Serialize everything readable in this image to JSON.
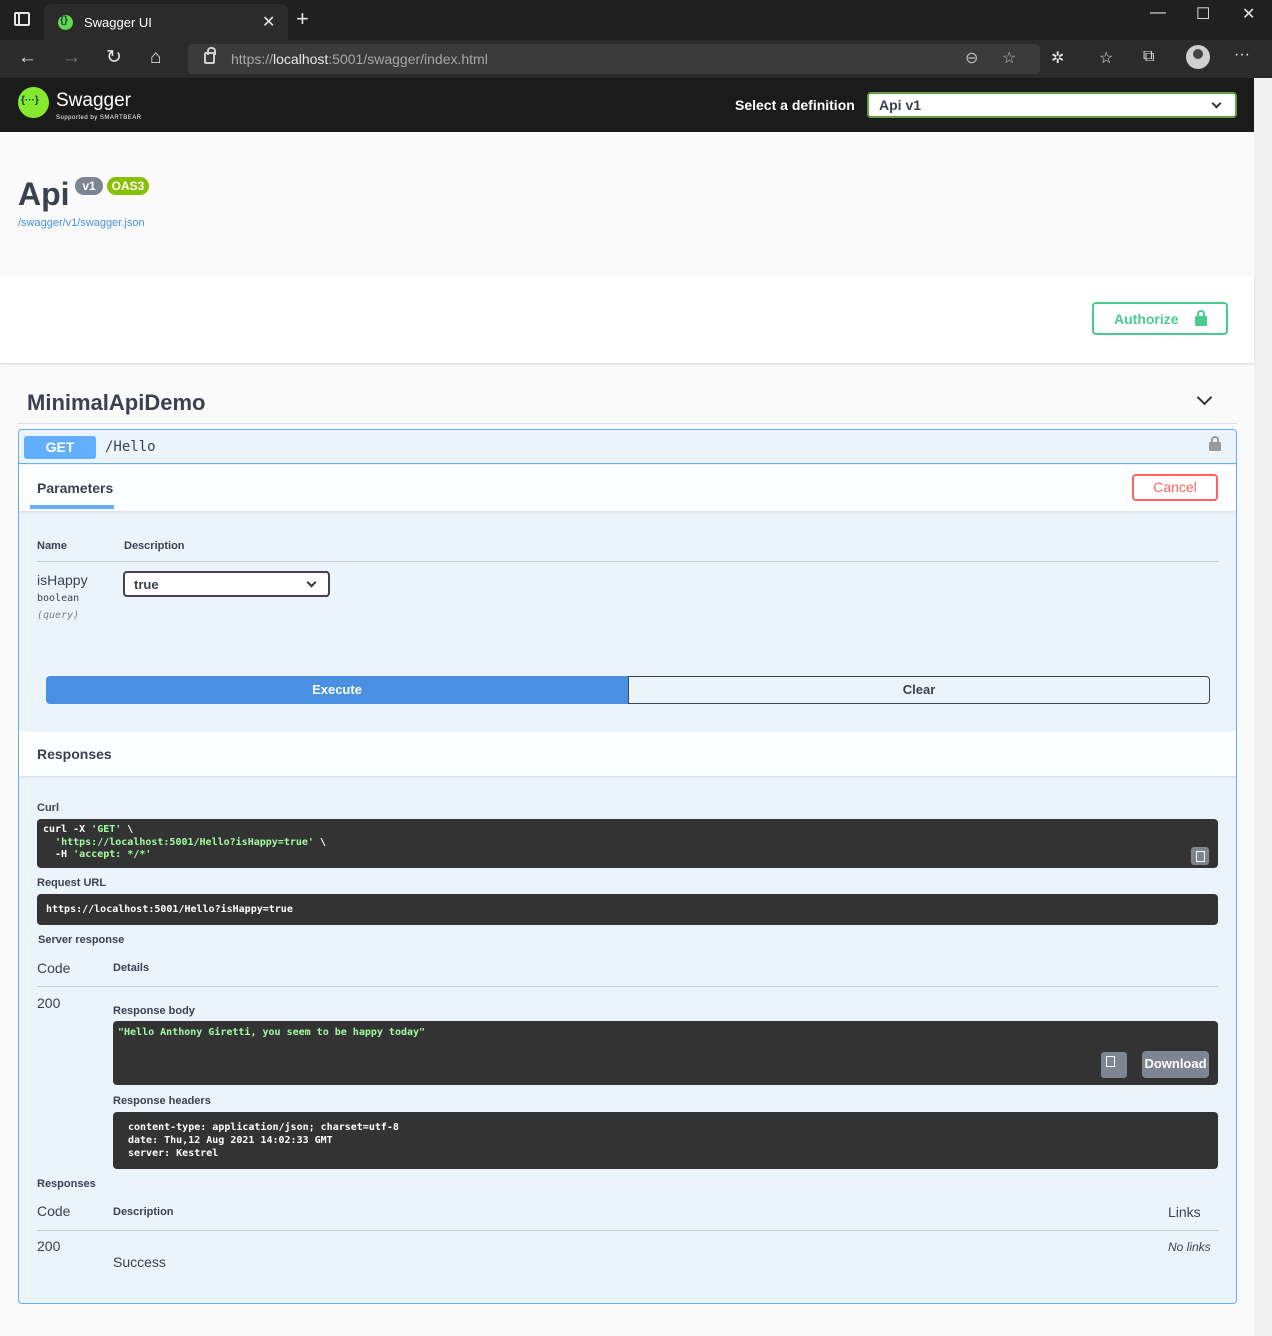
{
  "browser": {
    "tab_title": "Swagger UI",
    "url_scheme": "https://",
    "url_host": "localhost",
    "url_rest": ":5001/swagger/index.html"
  },
  "topbar": {
    "brand": "Swagger",
    "brand_sub": "Supported by SMARTBEAR",
    "definition_label": "Select a definition",
    "definition_value": "Api v1"
  },
  "info": {
    "title": "Api",
    "version_badge": "v1",
    "oas_badge": "OAS3",
    "spec_url": "/swagger/v1/swagger.json"
  },
  "scheme": {
    "authorize_label": "Authorize"
  },
  "tag": {
    "name": "MinimalApiDemo"
  },
  "operation": {
    "method": "GET",
    "path": "/Hello",
    "params_tab": "Parameters",
    "cancel_label": "Cancel",
    "col_name": "Name",
    "col_description": "Description",
    "param": {
      "name": "isHappy",
      "type": "boolean",
      "in": "(query)",
      "value": "true"
    },
    "execute_label": "Execute",
    "clear_label": "Clear",
    "responses_title": "Responses"
  },
  "live": {
    "curl_label": "Curl",
    "curl_lines": [
      {
        "a": "curl -X ",
        "b": "'GET'",
        "c": " \\"
      },
      {
        "a": "  ",
        "b": "'https://localhost:5001/Hello?isHappy=true'",
        "c": " \\"
      },
      {
        "a": "  -H ",
        "b": "'accept: */*'",
        "c": ""
      }
    ],
    "request_url_label": "Request URL",
    "request_url": "https://localhost:5001/Hello?isHappy=true",
    "server_response_label": "Server response",
    "code_col": "Code",
    "details_col": "Details",
    "code": "200",
    "response_body_label": "Response body",
    "response_body": "\"Hello Anthony Giretti, you seem to be happy today\"",
    "download_label": "Download",
    "response_headers_label": "Response headers",
    "headers": [
      "content-type: application/json; charset=utf-8",
      "date: Thu,12 Aug 2021 14:02:33 GMT",
      "server: Kestrel"
    ]
  },
  "documented": {
    "title": "Responses",
    "code_col": "Code",
    "description_col": "Description",
    "links_col": "Links",
    "code": "200",
    "description": "Success",
    "links": "No links"
  }
}
